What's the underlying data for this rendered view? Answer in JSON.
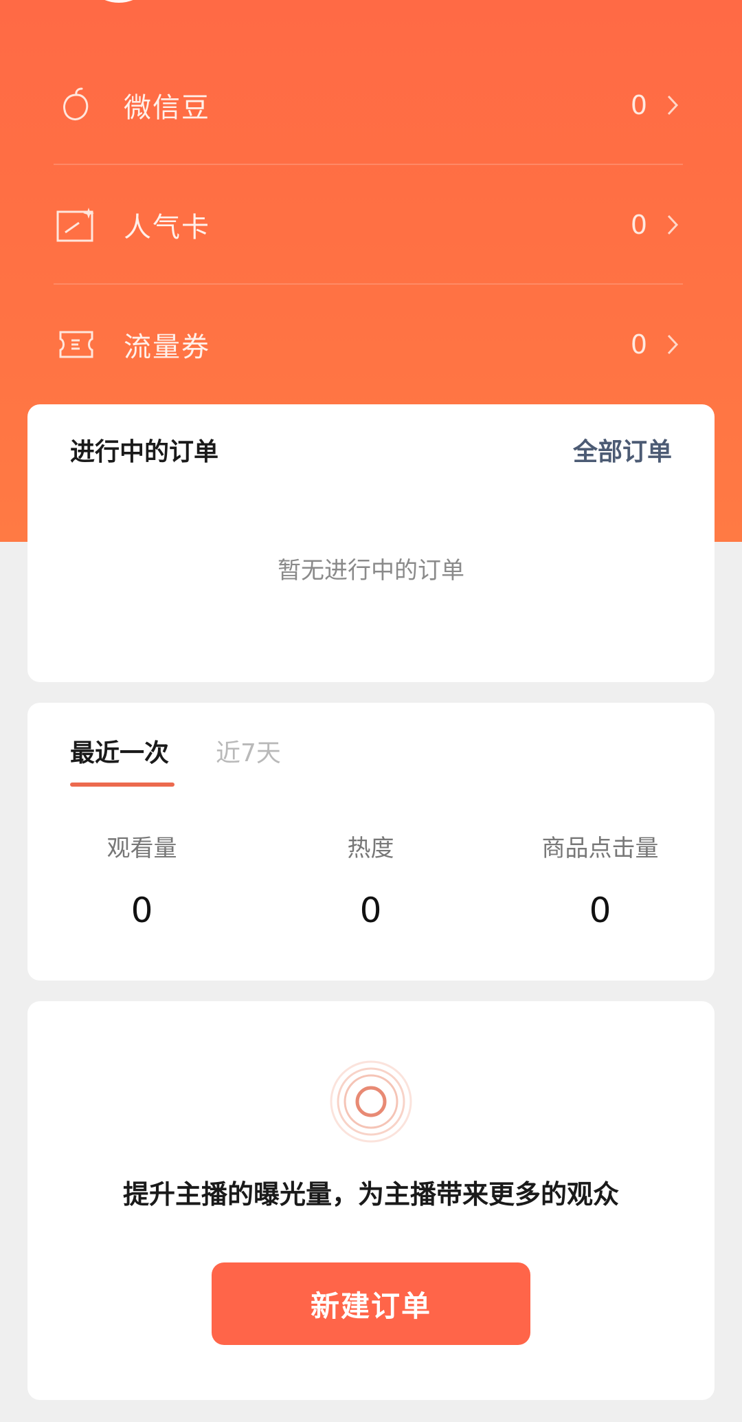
{
  "assets": {
    "items": [
      {
        "label": "微信豆",
        "value": "0",
        "icon": "bean-icon"
      },
      {
        "label": "人气卡",
        "value": "0",
        "icon": "popularity-card-icon"
      },
      {
        "label": "流量券",
        "value": "0",
        "icon": "traffic-coupon-icon"
      }
    ]
  },
  "orders": {
    "title": "进行中的订单",
    "all_link": "全部订单",
    "empty_text": "暂无进行中的订单"
  },
  "stats": {
    "tabs": [
      {
        "label": "最近一次",
        "active": true
      },
      {
        "label": "近7天",
        "active": false
      }
    ],
    "metrics": [
      {
        "label": "观看量",
        "value": "0"
      },
      {
        "label": "热度",
        "value": "0"
      },
      {
        "label": "商品点击量",
        "value": "0"
      }
    ]
  },
  "promo": {
    "text": "提升主播的曝光量，为主播带来更多的观众",
    "button": "新建订单",
    "icon": "broadcast-ring-icon"
  },
  "colors": {
    "header": "#ff6a45",
    "accent": "#ff6549",
    "link": "#4c5b74"
  }
}
